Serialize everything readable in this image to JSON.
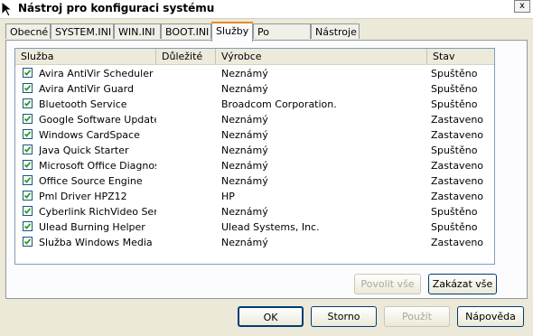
{
  "window": {
    "title": "Nástroj pro konfiguraci systému",
    "close_label": "x"
  },
  "tabs": [
    {
      "label": "Obecné"
    },
    {
      "label": "SYSTEM.INI"
    },
    {
      "label": "WIN.INI"
    },
    {
      "label": "BOOT.INI"
    },
    {
      "label": "Služby"
    },
    {
      "label": "Po spuštění"
    },
    {
      "label": "Nástroje"
    }
  ],
  "active_tab": "Služby",
  "columns": [
    "Služba",
    "Důležité",
    "Výrobce",
    "Stav"
  ],
  "services": [
    {
      "name": "Avira AntiVir Scheduler",
      "important": "",
      "vendor": "Neznámý",
      "status": "Spuštěno",
      "checked": true
    },
    {
      "name": "Avira AntiVir Guard",
      "important": "",
      "vendor": "Neznámý",
      "status": "Spuštěno",
      "checked": true
    },
    {
      "name": "Bluetooth Service",
      "important": "",
      "vendor": "Broadcom Corporation.",
      "status": "Spuštěno",
      "checked": true
    },
    {
      "name": "Google Software Updater",
      "important": "",
      "vendor": "Neznámý",
      "status": "Zastaveno",
      "checked": true
    },
    {
      "name": "Windows CardSpace",
      "important": "",
      "vendor": "Neznámý",
      "status": "Zastaveno",
      "checked": true
    },
    {
      "name": "Java Quick Starter",
      "important": "",
      "vendor": "Neznámý",
      "status": "Spuštěno",
      "checked": true
    },
    {
      "name": "Microsoft Office Diagnos...",
      "important": "",
      "vendor": "Neznámý",
      "status": "Zastaveno",
      "checked": true
    },
    {
      "name": "Office Source Engine",
      "important": "",
      "vendor": "Neznámý",
      "status": "Zastaveno",
      "checked": true
    },
    {
      "name": "Pml Driver HPZ12",
      "important": "",
      "vendor": "HP",
      "status": "Zastaveno",
      "checked": true
    },
    {
      "name": "Cyberlink RichVideo Serv...",
      "important": "",
      "vendor": "Neznámý",
      "status": "Spuštěno",
      "checked": true
    },
    {
      "name": "Ulead Burning Helper",
      "important": "",
      "vendor": "Ulead Systems, Inc.",
      "status": "Spuštěno",
      "checked": true
    },
    {
      "name": "Služba Windows Media Pl...",
      "important": "",
      "vendor": "Neznámý",
      "status": "Zastaveno",
      "checked": true
    }
  ],
  "panel_buttons": {
    "enable_all": "Povolit vše",
    "disable_all": "Zakázat vše"
  },
  "dialog_buttons": {
    "ok": "OK",
    "cancel": "Storno",
    "apply": "Použít",
    "help": "Nápověda"
  },
  "colors": {
    "active_tab_accent": "#e68b2c",
    "button_border": "#003c74",
    "check_border": "#1c5180",
    "check_mark": "#21a121"
  }
}
